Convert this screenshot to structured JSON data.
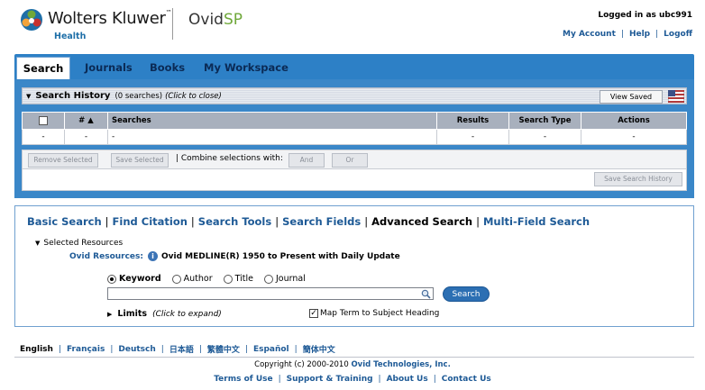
{
  "header": {
    "brand": "Wolters Kluwer",
    "brand_tm": "™",
    "brand_sub": "Health",
    "product_prefix": "Ovid",
    "product_suffix": "SP",
    "logged_in": "Logged in as ubc991",
    "links": [
      "My Account",
      "Help",
      "Logoff"
    ]
  },
  "tabs": [
    "Search",
    "Journals",
    "Books",
    "My Workspace"
  ],
  "history": {
    "title": "Search History",
    "count": "(0 searches)",
    "close_hint": "(Click to close)",
    "view_saved": "View Saved",
    "columns": [
      "#",
      "Searches",
      "Results",
      "Search Type",
      "Actions"
    ],
    "sort_glyph": "▲",
    "row": [
      "-",
      "-",
      "-",
      "-",
      "-",
      "-"
    ],
    "remove_selected": "Remove Selected",
    "save_selected": "Save Selected",
    "combine_label": "| Combine selections with:",
    "and_label": "And",
    "or_label": "Or",
    "save_history": "Save Search History"
  },
  "subnav": [
    "Basic Search",
    "Find Citation",
    "Search Tools",
    "Search Fields",
    "Advanced Search",
    "Multi-Field Search"
  ],
  "resources": {
    "toggle_label": "Selected Resources",
    "label": "Ovid Resources:",
    "database": "Ovid MEDLINE(R) 1950 to Present with Daily Update"
  },
  "search": {
    "radios": [
      "Keyword",
      "Author",
      "Title",
      "Journal"
    ],
    "selected": "Keyword",
    "input_value": "",
    "button": "Search",
    "limits_label": "Limits",
    "limits_hint": "(Click to expand)",
    "map_term": "Map Term to Subject Heading"
  },
  "footer": {
    "languages": [
      "English",
      "Français",
      "Deutsch",
      "日本語",
      "繁體中文",
      "Español",
      "簡体中文"
    ],
    "copyright_prefix": "Copyright (c) 2000-2010",
    "copyright_company": "Ovid Technologies, Inc.",
    "links": [
      "Terms of Use",
      "Support & Training",
      "About Us",
      "Contact Us"
    ]
  },
  "colors": {
    "tab_bar": "#2d80c6",
    "link": "#1e5a96",
    "search_button": "#2c6fb3"
  }
}
